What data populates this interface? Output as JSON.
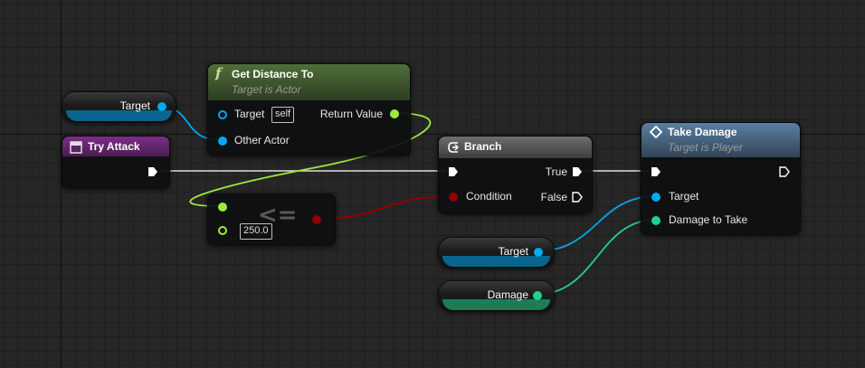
{
  "nodes": {
    "get_distance": {
      "title": "Get Distance To",
      "subtitle": "Target is Actor",
      "icon_glyph": "f",
      "pin_target": "Target",
      "pin_target_default": "self",
      "pin_other": "Other Actor",
      "pin_return": "Return Value"
    },
    "try_attack": {
      "title": "Try Attack"
    },
    "branch": {
      "title": "Branch",
      "pin_true": "True",
      "pin_condition": "Condition",
      "pin_false": "False"
    },
    "take_damage": {
      "title": "Take Damage",
      "subtitle": "Target is Player",
      "pin_target": "Target",
      "pin_damage": "Damage to Take"
    },
    "less_equal": {
      "operator": "<=",
      "value": "250.0"
    },
    "var_target_top": {
      "label": "Target"
    },
    "var_target_bottom": {
      "label": "Target"
    },
    "var_damage": {
      "label": "Damage"
    }
  },
  "colors": {
    "object_pin": "#00a8f2",
    "float_pin": "#9bea3c",
    "bool_pin": "#920101",
    "damage_pin": "#21d18b",
    "exec_pin": "#ffffff",
    "function_header": "#445e33",
    "event_header": "#6e2a79",
    "branch_header": "#5a5a5a",
    "member_function_header": "#4d6e8e"
  },
  "icons": {
    "function": "function-f-icon",
    "event": "event-box-icon",
    "branch": "branch-icon",
    "message": "diamond-icon"
  }
}
